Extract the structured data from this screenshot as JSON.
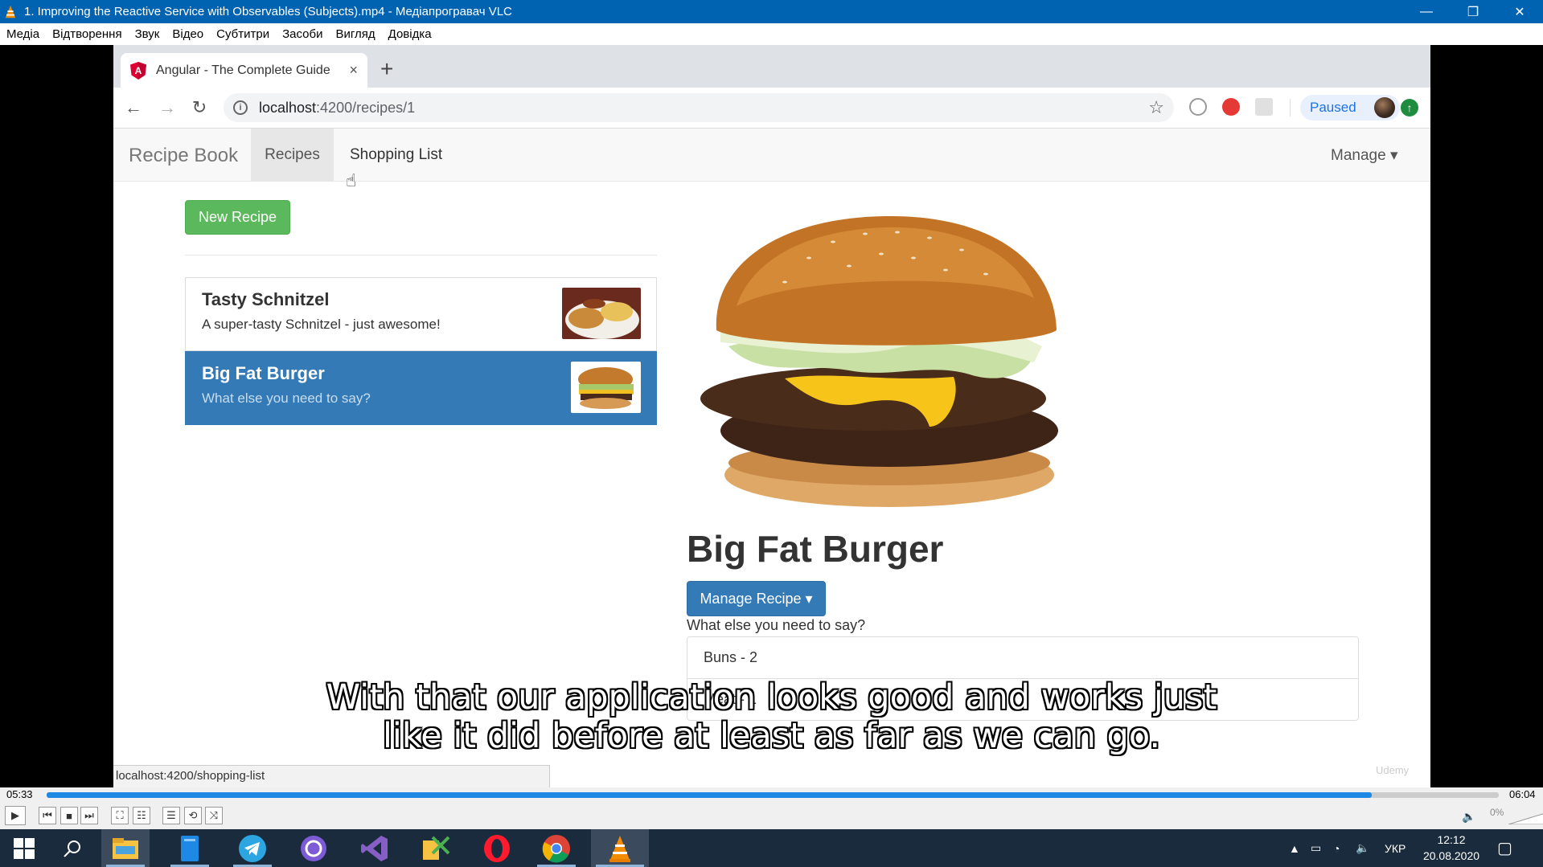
{
  "window": {
    "title": "1. Improving the Reactive Service with Observables (Subjects).mp4 - Медіапрогравач VLC",
    "minimize": "—",
    "restore": "❐",
    "close": "✕"
  },
  "menu": {
    "items": [
      "Медіа",
      "Відтворення",
      "Звук",
      "Відео",
      "Субтитри",
      "Засоби",
      "Вигляд",
      "Довідка"
    ]
  },
  "browser": {
    "tab_title": "Angular - The Complete Guide",
    "tab_close": "×",
    "new_tab": "+",
    "url_host": "localhost",
    "url_path": ":4200/recipes/1",
    "profile_label": "Paused",
    "status_url": "localhost:4200/shopping-list"
  },
  "app": {
    "brand": "Recipe Book",
    "nav_recipes": "Recipes",
    "nav_shopping": "Shopping List",
    "nav_manage": "Manage ▾",
    "new_recipe_label": "New Recipe",
    "recipes": [
      {
        "name": "Tasty Schnitzel",
        "description": "A super-tasty Schnitzel - just awesome!",
        "active": false
      },
      {
        "name": "Big Fat Burger",
        "description": "What else you need to say?",
        "active": true
      }
    ],
    "detail": {
      "title": "Big Fat Burger",
      "manage_label": "Manage Recipe ▾",
      "description": "What else you need to say?",
      "ingredients": [
        "Buns - 2",
        "Meat - 1"
      ]
    },
    "watermark": "Udemy"
  },
  "subtitle": {
    "line1": "With that our application looks good and works just",
    "line2": "like it did before at least as far as we can go."
  },
  "player": {
    "elapsed": "05:33",
    "total": "06:04",
    "progress_fraction": 0.9125,
    "volume_label": "0%"
  },
  "taskbar": {
    "language": "УКР",
    "time": "12:12",
    "date": "20.08.2020"
  },
  "colors": {
    "accent_blue": "#337ab7",
    "success_green": "#5cb85c",
    "vlc_title": "#0063b1",
    "seek_blue": "#1e88e5"
  }
}
